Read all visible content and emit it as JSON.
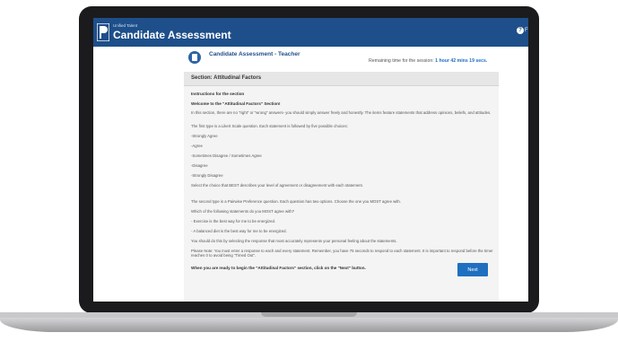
{
  "app": {
    "brand": "Unified Talent",
    "title": "Candidate Assessment",
    "help_label": "F",
    "help_icon": "help-icon"
  },
  "assessment": {
    "title": "Candidate Assessment - Teacher",
    "timer_label": "Remaining time for the session:",
    "timer_value": "1 hour 42 mins 19 secs."
  },
  "section": {
    "title": "Section: Attitudinal Factors"
  },
  "instructions": {
    "heading": "Instructions for the section",
    "welcome": "Welcome to the \"Attitudinal Factors\" Section!",
    "intro": "In this section, there are no \"right\" or \"wrong\" answers- you should simply answer freely and honestly. The items feature statements that address opinions, beliefs, and attitudes.",
    "likert_intro": "The first type is a Likert Scale question. Each statement is followed by five possible choices:",
    "choices": [
      "-Strongly Agree",
      "-Agree",
      "-Sometimes Disagree / Sometimes Agree",
      "-Disagree",
      "-Strongly Disagree"
    ],
    "likert_select": "Select the choice that BEST describes your level of agreement or disagreement with each statement.",
    "pairwise_intro": "The second type is a Pairwise Preference question. Each question has two options. Choose the one you MOST agree with.",
    "example_question": "Which of the following statements do you MOST agree with?",
    "example_option_1": "- Exercise is the best way for me to be energized.",
    "example_option_2": "- A balanced diet is the best way for me to be energized.",
    "represent": "You should do this by selecting the response that most accurately represents your personal feeling about the statements.",
    "note": "Please Note: You must enter a response to each and every statement. Remember, you have 75 seconds to respond to each statement. It is important to respond before the timer reaches 0 to avoid being \"Timed Out\".",
    "ready": "When you are ready to begin the \"Attitudinal Factors\" section, click on the \"Next\" button."
  },
  "buttons": {
    "next": "Next"
  },
  "colors": {
    "header": "#1e4f8a",
    "accent": "#1f6fc1",
    "timer": "#1e6fc0"
  }
}
